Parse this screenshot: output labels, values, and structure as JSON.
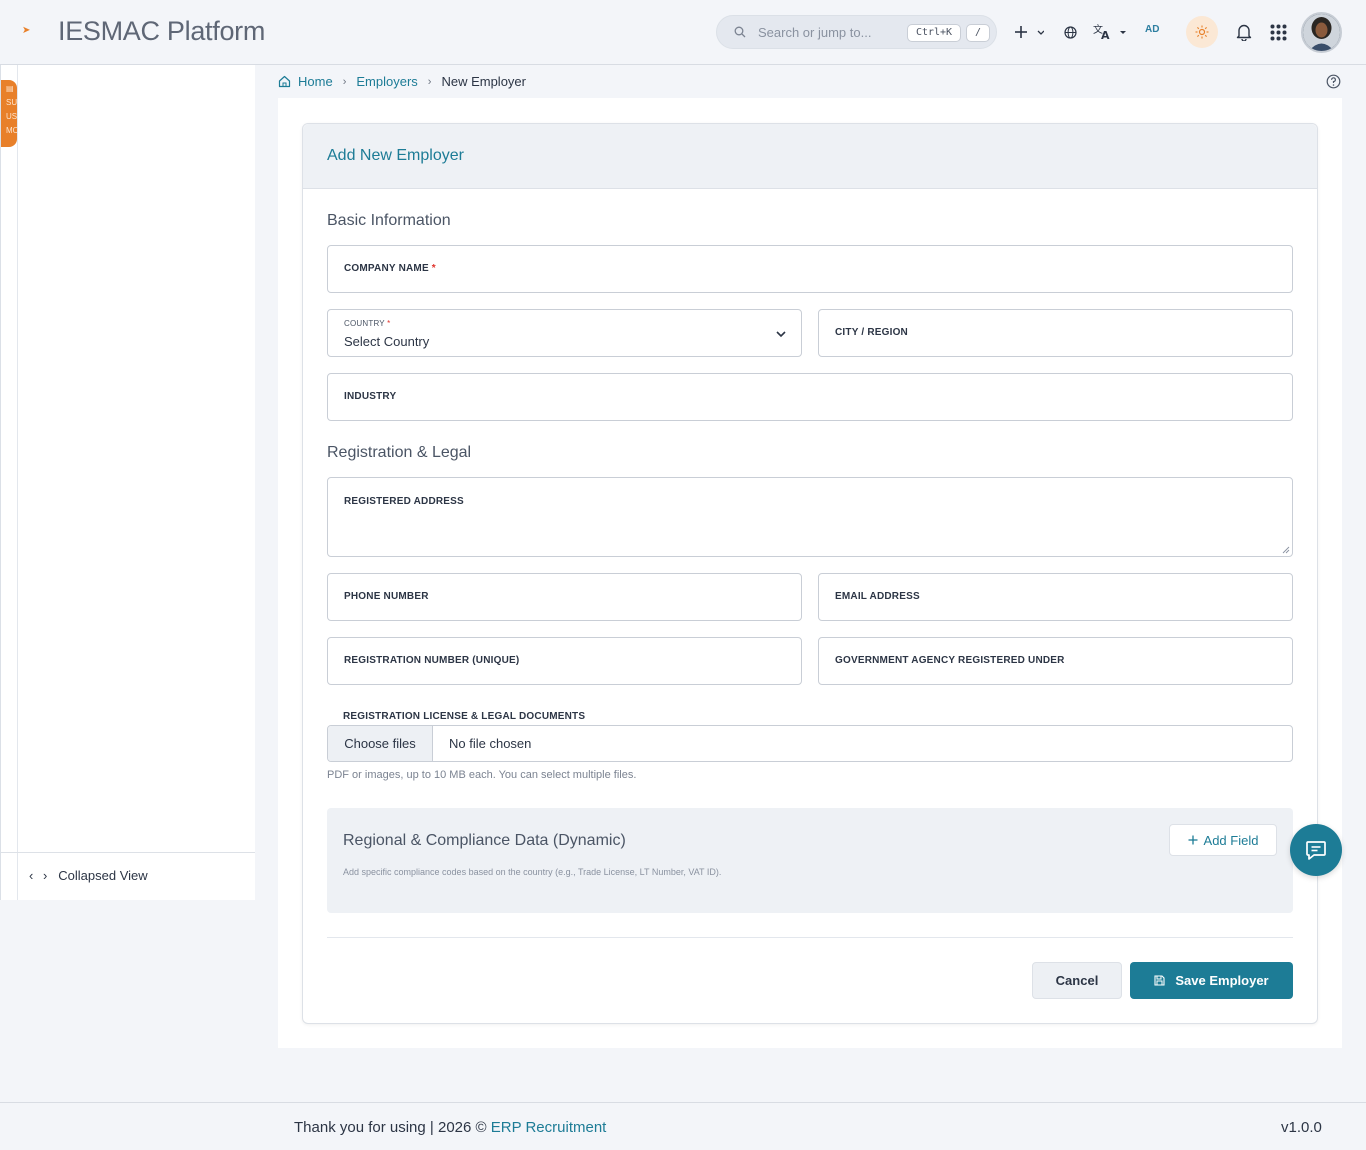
{
  "header": {
    "app_title": "IESMAC Platform",
    "search_placeholder": "Search or jump to...",
    "shortcut_primary": "Ctrl+K",
    "shortcut_secondary": "/",
    "user_initials": "AD",
    "icons": [
      "plus-icon",
      "globe-icon",
      "translate-icon",
      "sun-icon",
      "bell-icon",
      "apps-grid-icon"
    ]
  },
  "sidebar": {
    "tab_text": [
      "▤",
      "SU",
      "US",
      "MC"
    ],
    "collapse_label": "Collapsed View"
  },
  "breadcrumb": {
    "home": "Home",
    "employers": "Employers",
    "current": "New Employer"
  },
  "form": {
    "title": "Add New Employer",
    "sections": {
      "basic": "Basic Information",
      "legal": "Registration & Legal"
    },
    "fields": {
      "company_name": "COMPANY NAME",
      "country": "COUNTRY",
      "country_value": "Select Country",
      "city": "CITY / REGION",
      "industry": "INDUSTRY",
      "registered_address": "REGISTERED ADDRESS",
      "phone": "PHONE NUMBER",
      "email": "EMAIL ADDRESS",
      "registration_number": "REGISTRATION NUMBER (UNIQUE)",
      "gov_agency": "GOVERNMENT AGENCY REGISTERED UNDER",
      "required_mark": "*"
    },
    "upload": {
      "label": "REGISTRATION LICENSE & LEGAL DOCUMENTS",
      "button": "Choose files",
      "status": "No file chosen",
      "hint": "PDF or images, up to 10 MB each. You can select multiple files."
    },
    "dynamic": {
      "title": "Regional & Compliance Data (Dynamic)",
      "hint": "Add specific compliance codes based on the country (e.g., Trade License, LT Number, VAT ID).",
      "add_field": "Add Field"
    },
    "actions": {
      "cancel": "Cancel",
      "save": "Save Employer"
    }
  },
  "footer": {
    "text": "Thank you for using | 2026 ©",
    "link": "ERP Recruitment",
    "version": "v1.0.0"
  },
  "colors": {
    "accent": "#1d7c96",
    "brand_orange": "#e8802a",
    "required": "#e0322b"
  }
}
